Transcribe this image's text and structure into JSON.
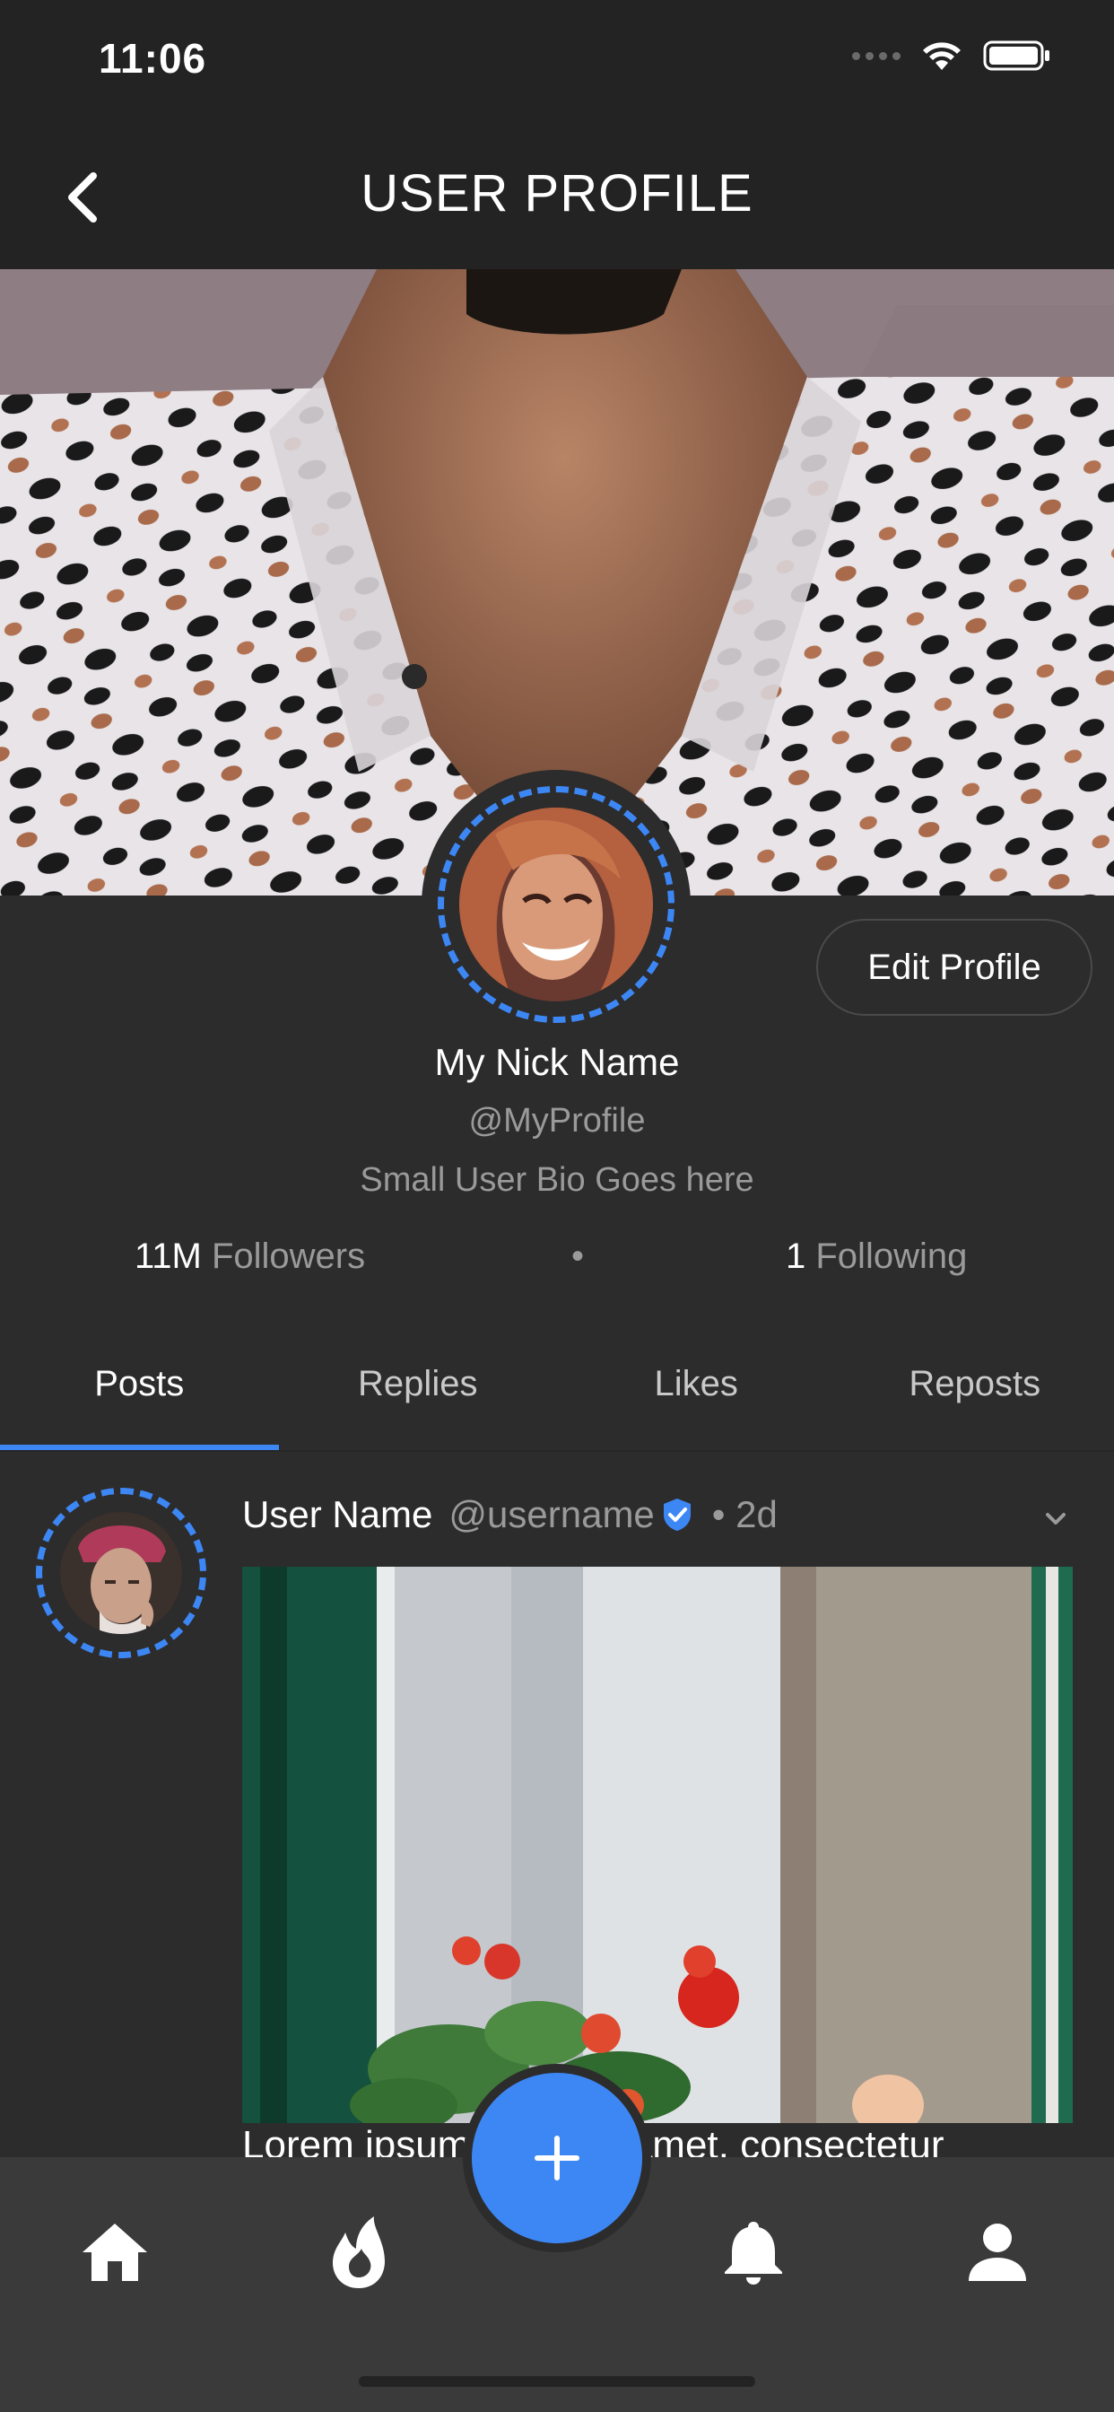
{
  "status_bar": {
    "time": "11:06"
  },
  "header": {
    "title": "USER PROFILE"
  },
  "profile": {
    "edit_label": "Edit Profile",
    "nick_name": "My Nick Name",
    "handle": "@MyProfile",
    "bio": "Small User Bio Goes here",
    "followers_count": "11M",
    "followers_label": "Followers",
    "separator": "•",
    "following_count": "1",
    "following_label": "Following"
  },
  "tabs": [
    {
      "label": "Posts",
      "active": true
    },
    {
      "label": "Replies",
      "active": false
    },
    {
      "label": "Likes",
      "active": false
    },
    {
      "label": "Reposts",
      "active": false
    }
  ],
  "post": {
    "user_name": "User Name",
    "username": "@username",
    "time": "• 2d",
    "text": "Lorem ipsum dolor sit amet, consectetur"
  },
  "bottom_nav": {
    "items": [
      "home-icon",
      "flame-icon",
      "add-icon",
      "bell-icon",
      "person-icon"
    ]
  },
  "colors": {
    "accent": "#3d87f5",
    "background": "#2c2c2c",
    "header": "#232323",
    "nav": "#3a3a3a"
  }
}
